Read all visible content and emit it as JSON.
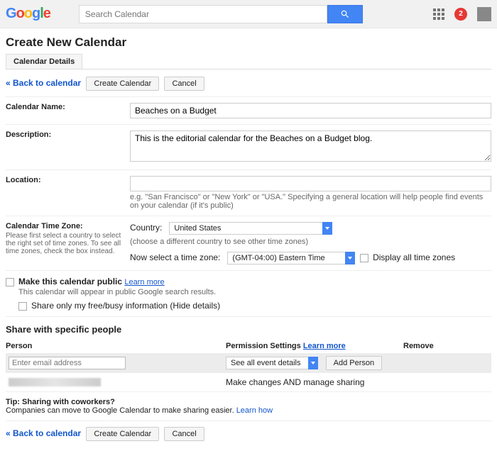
{
  "header": {
    "search_placeholder": "Search Calendar",
    "notif_count": "2"
  },
  "page": {
    "title": "Create New Calendar",
    "tab": "Calendar Details",
    "back_link": "« Back to calendar",
    "create_btn": "Create Calendar",
    "cancel_btn": "Cancel"
  },
  "fields": {
    "name_label": "Calendar Name:",
    "name_value": "Beaches on a Budget",
    "desc_label": "Description:",
    "desc_value": "This is the editorial calendar for the Beaches on a Budget blog.",
    "loc_label": "Location:",
    "loc_help": "e.g. \"San Francisco\" or \"New York\" or \"USA.\" Specifying a general location will help people find events on your calendar (if it's public)",
    "tz_label": "Calendar Time Zone:",
    "tz_hint": "Please first select a country to select the right set of time zones. To see all time zones, check the box instead.",
    "country_label": "Country:",
    "country_value": "United States",
    "country_help": "(choose a different country to see other time zones)",
    "tz_select_label": "Now select a time zone:",
    "tz_value": "(GMT-04:00) Eastern Time",
    "tz_all": "Display all time zones",
    "public_label": "Make this calendar public",
    "public_learn": "Learn more",
    "public_desc": "This calendar will appear in public Google search results.",
    "public_free": "Share only my free/busy information (Hide details)"
  },
  "share": {
    "heading": "Share with specific people",
    "col_person": "Person",
    "col_perm": "Permission Settings",
    "col_perm_link": "Learn more",
    "col_remove": "Remove",
    "email_placeholder": "Enter email address",
    "perm_value": "See all event details",
    "add_btn": "Add Person",
    "row_perm": "Make changes AND manage sharing"
  },
  "tip": {
    "title": "Tip: Sharing with coworkers?",
    "text": "Companies can move to Google Calendar to make sharing easier.",
    "link": "Learn how"
  }
}
